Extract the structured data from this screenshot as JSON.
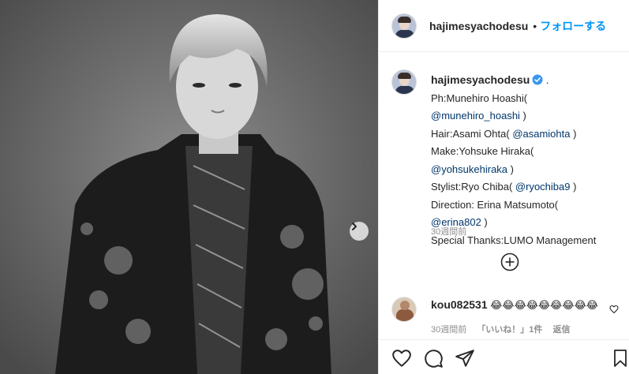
{
  "post": {
    "author": "hajimesyachodesu",
    "separator": "•",
    "follow_label": "フォローする",
    "caption": {
      "username": "hajimesyachodesu",
      "trail": ".",
      "lines": [
        {
          "text": "Ph:Munehiro Hoashi(",
          "mention": ""
        },
        {
          "text": "",
          "mention": "@munehiro_hoashi",
          "suffix": " )"
        },
        {
          "text": "Hair:Asami Ohta( ",
          "mention": "@asamiohta",
          "suffix": " )"
        },
        {
          "text": "Make:Yohsuke Hiraka(",
          "mention": ""
        },
        {
          "text": "",
          "mention": "@yohsukehiraka",
          "suffix": " )"
        },
        {
          "text": "Stylist:Ryo Chiba( ",
          "mention": "@ryochiba9",
          "suffix": " )"
        },
        {
          "text": "Direction: Erina Matsumoto(",
          "mention": ""
        },
        {
          "text": "",
          "mention": "@erina802",
          "suffix": " )"
        },
        {
          "text": "Special Thanks:LUMO Management",
          "mention": ""
        }
      ],
      "time": "30週間前"
    },
    "comment": {
      "username": "kou082531",
      "text": "😂😂😂😂😂😂😂😂😂",
      "time": "30週間前",
      "likes": "「いいね！」1件",
      "reply": "返信"
    }
  },
  "icons": {
    "verified": "verified-badge-icon",
    "next": "chevron-right-icon",
    "more_comments": "plus-circle-icon",
    "like": "heart-icon",
    "comment": "comment-bubble-icon",
    "share": "paper-plane-icon",
    "save": "bookmark-icon"
  },
  "colors": {
    "link_blue": "#0095f6",
    "mention": "#00376b",
    "verified": "#3897f0",
    "muted": "#8e8e8e"
  }
}
